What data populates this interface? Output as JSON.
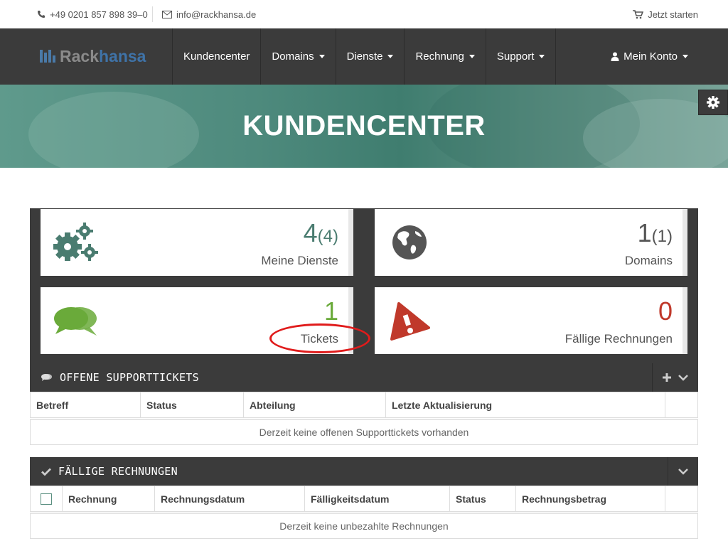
{
  "topbar": {
    "phone": "+49 0201 857 898 39–0",
    "email": "info@rackhansa.de",
    "start": "Jetzt starten"
  },
  "logo": {
    "part1": "Rack",
    "part2": "hansa"
  },
  "nav": {
    "items": [
      {
        "label": "Kundencenter",
        "dropdown": false
      },
      {
        "label": "Domains",
        "dropdown": true
      },
      {
        "label": "Dienste",
        "dropdown": true
      },
      {
        "label": "Rechnung",
        "dropdown": true
      },
      {
        "label": "Support",
        "dropdown": true
      }
    ],
    "account": "Mein Konto"
  },
  "hero": {
    "title": "KUNDENCENTER"
  },
  "stats": {
    "services": {
      "count": "4",
      "total": "(4)",
      "label": "Meine Dienste",
      "color": "#4a7c70"
    },
    "domains": {
      "count": "1",
      "total": "(1)",
      "label": "Domains",
      "color": "#555555"
    },
    "tickets": {
      "count": "1",
      "label": "Tickets",
      "color": "#6aaa3a"
    },
    "invoices": {
      "count": "0",
      "label": "Fällige Rechnungen",
      "color": "#c0392b"
    }
  },
  "tickets_panel": {
    "title": "OFFENE SUPPORTTICKETS",
    "columns": [
      "Betreff",
      "Status",
      "Abteilung",
      "Letzte Aktualisierung"
    ],
    "empty": "Derzeit keine offenen Supporttickets vorhanden"
  },
  "invoices_panel": {
    "title": "FÄLLIGE RECHNUNGEN",
    "columns": [
      "Rechnung",
      "Rechnungsdatum",
      "Fälligkeitsdatum",
      "Status",
      "Rechnungsbetrag"
    ],
    "empty": "Derzeit keine unbezahlte Rechnungen"
  },
  "colors": {
    "dark": "#3b3b3b",
    "accent": "#4a7c70",
    "highlight": "#e01b1b"
  }
}
